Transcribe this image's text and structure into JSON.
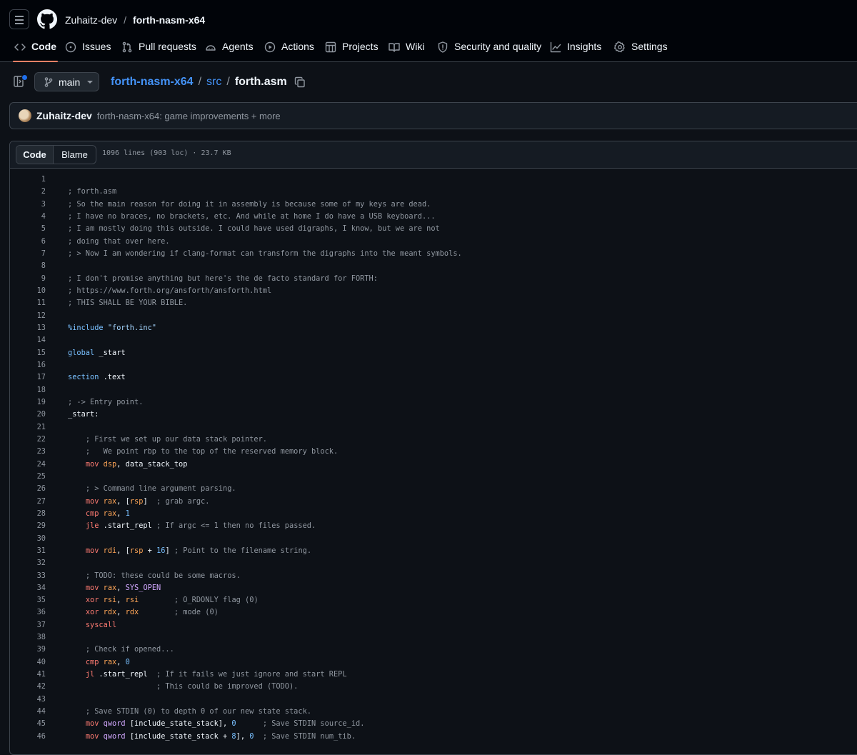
{
  "nav": {
    "owner": "Zuhaitz-dev",
    "repo": "forth-nasm-x64",
    "tabs": [
      {
        "label": "Code",
        "icon": "code-icon",
        "active": true
      },
      {
        "label": "Issues",
        "icon": "issue-icon"
      },
      {
        "label": "Pull requests",
        "icon": "pull-request-icon"
      },
      {
        "label": "Agents",
        "icon": "agents-icon"
      },
      {
        "label": "Actions",
        "icon": "play-icon"
      },
      {
        "label": "Projects",
        "icon": "table-icon"
      },
      {
        "label": "Wiki",
        "icon": "book-icon"
      },
      {
        "label": "Security and quality",
        "icon": "shield-icon"
      },
      {
        "label": "Insights",
        "icon": "graph-icon"
      },
      {
        "label": "Settings",
        "icon": "gear-icon"
      }
    ]
  },
  "file_nav": {
    "branch": "main",
    "crumb_repo": "forth-nasm-x64",
    "crumb_dir": "src",
    "crumb_file": "forth.asm"
  },
  "commit": {
    "author": "Zuhaitz-dev",
    "message": "forth-nasm-x64: game improvements + more"
  },
  "code_header": {
    "code_tab": "Code",
    "blame_tab": "Blame",
    "meta": "1096 lines (903 loc) · 23.7 KB"
  },
  "lines": [
    {
      "n": "1",
      "t": ""
    },
    {
      "n": "2",
      "t": "; forth.asm"
    },
    {
      "n": "3",
      "t": "; So the main reason for doing it in assembly is because some of my keys are dead."
    },
    {
      "n": "4",
      "t": "; I have no braces, no brackets, etc. And while at home I do have a USB keyboard..."
    },
    {
      "n": "5",
      "t": "; I am mostly doing this outside. I could have used digraphs, I know, but we are not"
    },
    {
      "n": "6",
      "t": "; doing that over here."
    },
    {
      "n": "7",
      "t": "; > Now I am wondering if clang-format can transform the digraphs into the meant symbols."
    },
    {
      "n": "8",
      "t": ""
    },
    {
      "n": "9",
      "t": "; I don't promise anything but here's the de facto standard for FORTH:"
    },
    {
      "n": "10",
      "t": "; https://www.forth.org/ansforth/ansforth.html"
    },
    {
      "n": "11",
      "t": "; THIS SHALL BE YOUR BIBLE."
    },
    {
      "n": "12",
      "t": ""
    },
    {
      "n": "13",
      "t": "%include \"forth.inc\""
    },
    {
      "n": "14",
      "t": ""
    },
    {
      "n": "15",
      "t": "global _start"
    },
    {
      "n": "16",
      "t": ""
    },
    {
      "n": "17",
      "t": "section .text"
    },
    {
      "n": "18",
      "t": ""
    },
    {
      "n": "19",
      "t": "; -> Entry point."
    },
    {
      "n": "20",
      "t": "_start:"
    },
    {
      "n": "21",
      "t": ""
    },
    {
      "n": "22",
      "t": "    ; First we set up our data stack pointer."
    },
    {
      "n": "23",
      "t": "    ;   We point rbp to the top of the reserved memory block."
    },
    {
      "n": "24",
      "t": "    mov dsp, data_stack_top"
    },
    {
      "n": "25",
      "t": ""
    },
    {
      "n": "26",
      "t": "    ; > Command line argument parsing."
    },
    {
      "n": "27",
      "t": "    mov rax, [rsp]  ; grab argc."
    },
    {
      "n": "28",
      "t": "    cmp rax, 1"
    },
    {
      "n": "29",
      "t": "    jle .start_repl ; If argc <= 1 then no files passed."
    },
    {
      "n": "30",
      "t": ""
    },
    {
      "n": "31",
      "t": "    mov rdi, [rsp + 16] ; Point to the filename string."
    },
    {
      "n": "32",
      "t": ""
    },
    {
      "n": "33",
      "t": "    ; TODO: these could be some macros."
    },
    {
      "n": "34",
      "t": "    mov rax, SYS_OPEN"
    },
    {
      "n": "35",
      "t": "    xor rsi, rsi        ; O_RDONLY flag (0)"
    },
    {
      "n": "36",
      "t": "    xor rdx, rdx        ; mode (0)"
    },
    {
      "n": "37",
      "t": "    syscall"
    },
    {
      "n": "38",
      "t": ""
    },
    {
      "n": "39",
      "t": "    ; Check if opened..."
    },
    {
      "n": "40",
      "t": "    cmp rax, 0"
    },
    {
      "n": "41",
      "t": "    jl .start_repl  ; If it fails we just ignore and start REPL"
    },
    {
      "n": "42",
      "t": "                    ; This could be improved (TODO)."
    },
    {
      "n": "43",
      "t": ""
    },
    {
      "n": "44",
      "t": "    ; Save STDIN (0) to depth 0 of our new state stack."
    },
    {
      "n": "45",
      "t": "    mov qword [include_state_stack], 0      ; Save STDIN source_id."
    },
    {
      "n": "46",
      "t": "    mov qword [include_state_stack + 8], 0  ; Save STDIN num_tib."
    }
  ]
}
